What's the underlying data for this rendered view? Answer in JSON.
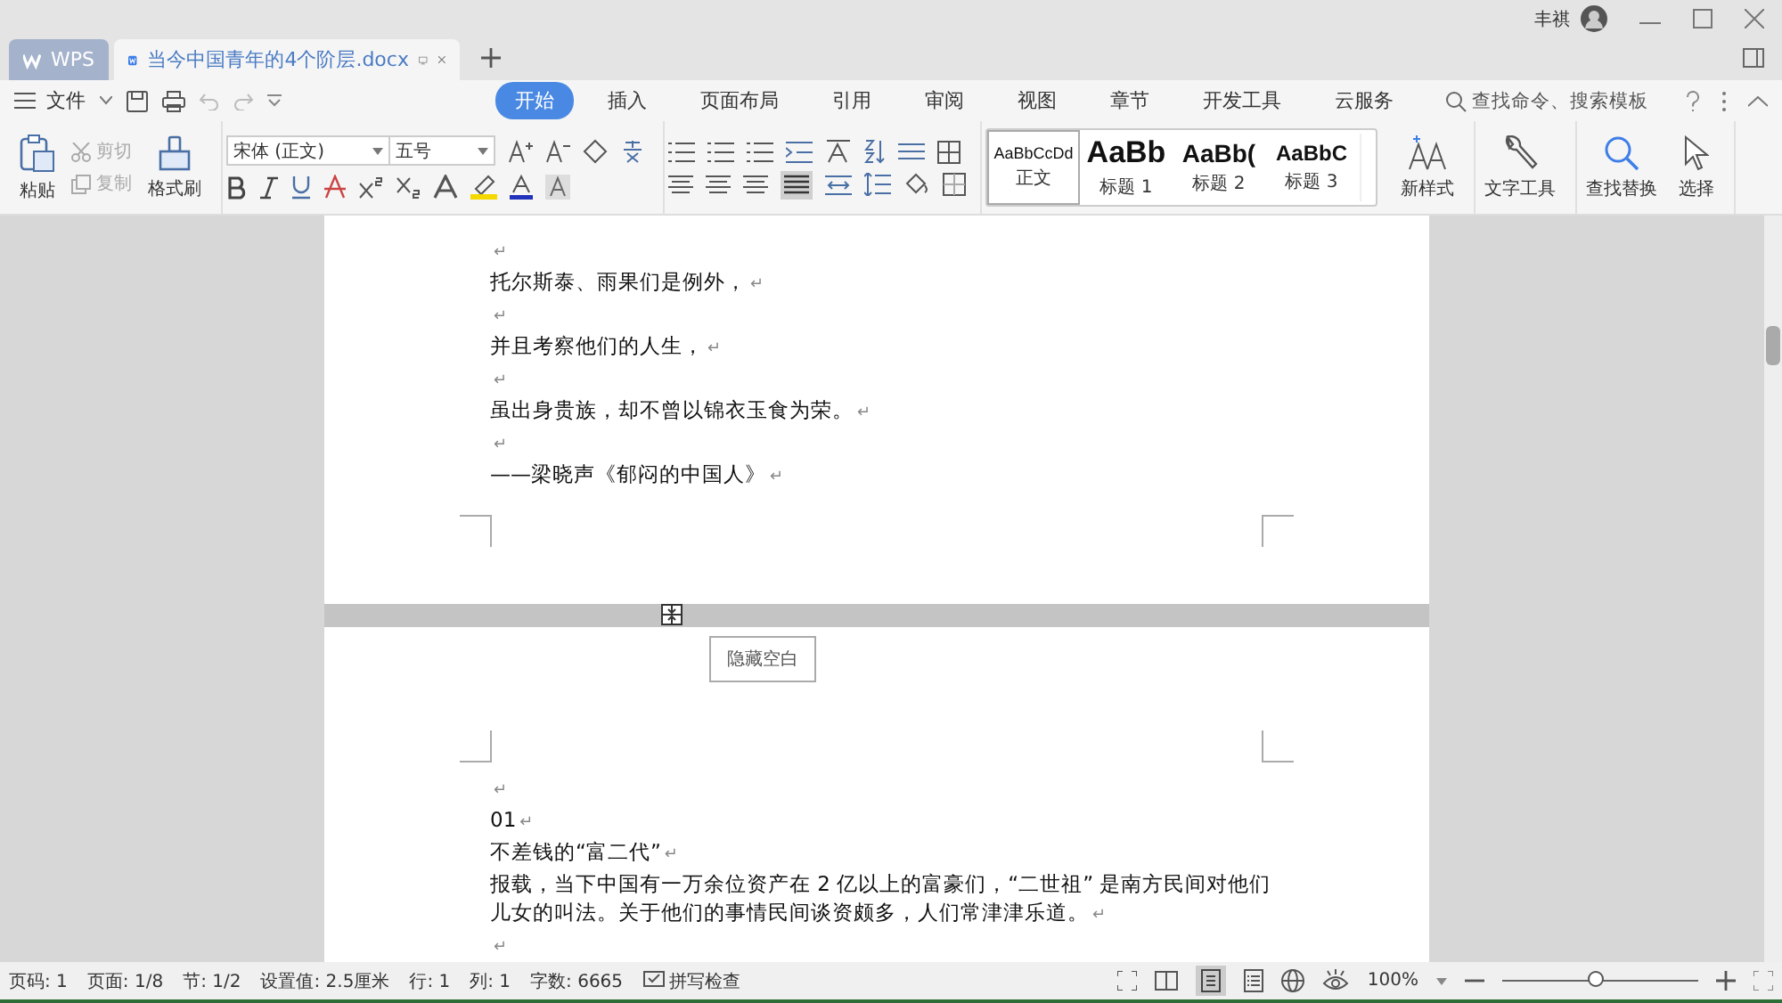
{
  "window": {
    "tabs": [
      {
        "kind": "home",
        "label": "WPS",
        "selected": false
      },
      {
        "kind": "doc",
        "label": "当今中国青年的4个阶层.docx",
        "selected": true
      }
    ],
    "user": "丰祺"
  },
  "menu": {
    "file": "文件",
    "tabs": [
      {
        "label": "开始",
        "selected": true
      },
      {
        "label": "插入",
        "selected": false
      },
      {
        "label": "页面布局",
        "selected": false
      },
      {
        "label": "引用",
        "selected": false
      },
      {
        "label": "审阅",
        "selected": false
      },
      {
        "label": "视图",
        "selected": false
      },
      {
        "label": "章节",
        "selected": false
      },
      {
        "label": "开发工具",
        "selected": false
      },
      {
        "label": "云服务",
        "selected": false
      }
    ],
    "search": {
      "placeholder": "查找命令、搜索模板"
    }
  },
  "ribbon": {
    "clipboard": {
      "paste": "粘贴",
      "cut": {
        "label": "剪切",
        "disabled": true
      },
      "copy": {
        "label": "复制",
        "disabled": true
      },
      "painter": "格式刷"
    },
    "font": {
      "name": "宋体 (正文)",
      "size": "五号"
    },
    "styles": [
      {
        "kind": "body",
        "preview": "AaBbCcDd",
        "label": "正文",
        "selected": true
      },
      {
        "kind": "h1",
        "preview": "AaBb",
        "label": "标题 1",
        "selected": false
      },
      {
        "kind": "h2",
        "preview": "AaBb(",
        "label": "标题 2",
        "selected": false
      },
      {
        "kind": "h3",
        "preview": "AaBbC",
        "label": "标题 3",
        "selected": false
      }
    ],
    "new_style": "新样式",
    "text_tools": "文字工具",
    "find_replace": "查找替换",
    "select": "选择"
  },
  "document": {
    "pages": [
      {
        "paragraphs": [
          {
            "end": "↵"
          },
          {
            "text": "托尔斯泰、雨果们是例外，",
            "end": "↵"
          },
          {
            "end": "↵"
          },
          {
            "text": "并且考察他们的人生，",
            "end": "↵"
          },
          {
            "end": "↵"
          },
          {
            "text": "虽出身贵族，却不曾以锦衣玉食为荣。",
            "end": "↵"
          },
          {
            "end": "↵"
          },
          {
            "text": "——梁晓声《郁闷的中国人》",
            "end": "↵"
          }
        ]
      },
      {
        "hide_blank": "隐藏空白",
        "paragraphs": [
          {
            "end": "↵"
          },
          {
            "text": "01",
            "end": "↵"
          },
          {
            "text": "不差钱的“富二代”",
            "end": "↵"
          },
          {
            "text": "报载，当下中国有一万余位资产在 2 亿以上的富豪们，“二世祖” 是南方民间对他们儿女的叫法。关于他们的事情民间谈资颇多，人们常津津乐道。",
            "end": "↵"
          },
          {
            "end": "↵"
          }
        ]
      }
    ]
  },
  "status_bar": {
    "items": [
      "页码: 1",
      "页面: 1/8",
      "节: 1/2",
      "设置值: 2.5厘米",
      "行: 1",
      "列: 1",
      "字数: 6665"
    ],
    "spell_check": "拼写检查",
    "zoom": "100%",
    "zoom_slider": {
      "level": 0.48
    }
  }
}
